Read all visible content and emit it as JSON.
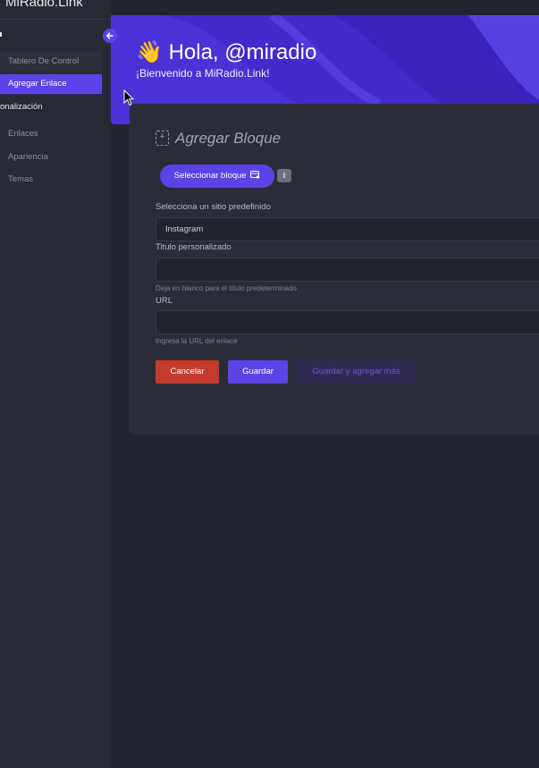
{
  "app": {
    "brand": "MiRadio.Link"
  },
  "sidebar": {
    "items": [
      {
        "label": "Tablero De Control"
      },
      {
        "label": "Agregar Enlace"
      }
    ],
    "section_title": "onalización",
    "sub_items": [
      {
        "label": "Enlaces"
      },
      {
        "label": "Apariencia"
      },
      {
        "label": "Temas"
      }
    ]
  },
  "banner": {
    "emoji": "👋",
    "greeting": "Hola, @miradio",
    "welcome": "¡Bienvenido a MiRadio.Link!"
  },
  "card": {
    "title": "Agregar Bloque",
    "select_block_label": "Seleccionar bloque",
    "info_badge": "i",
    "preset_label": "Selecciona un sitio predefinido",
    "preset_value": "Instagram",
    "title_label": "Titulo personalizado",
    "title_value": "",
    "title_hint": "Deja en blanco para el título predeterminado",
    "url_label": "URL",
    "url_value": "",
    "url_hint": "Ingresa la URL del enlace",
    "cancel_label": "Cancelar",
    "save_label": "Guardar",
    "save_more_label": "Guardar y agregar más"
  },
  "colors": {
    "accent": "#5b43e8",
    "banner": "#4a32d6",
    "danger": "#c53a2c",
    "background": "#22242f"
  }
}
